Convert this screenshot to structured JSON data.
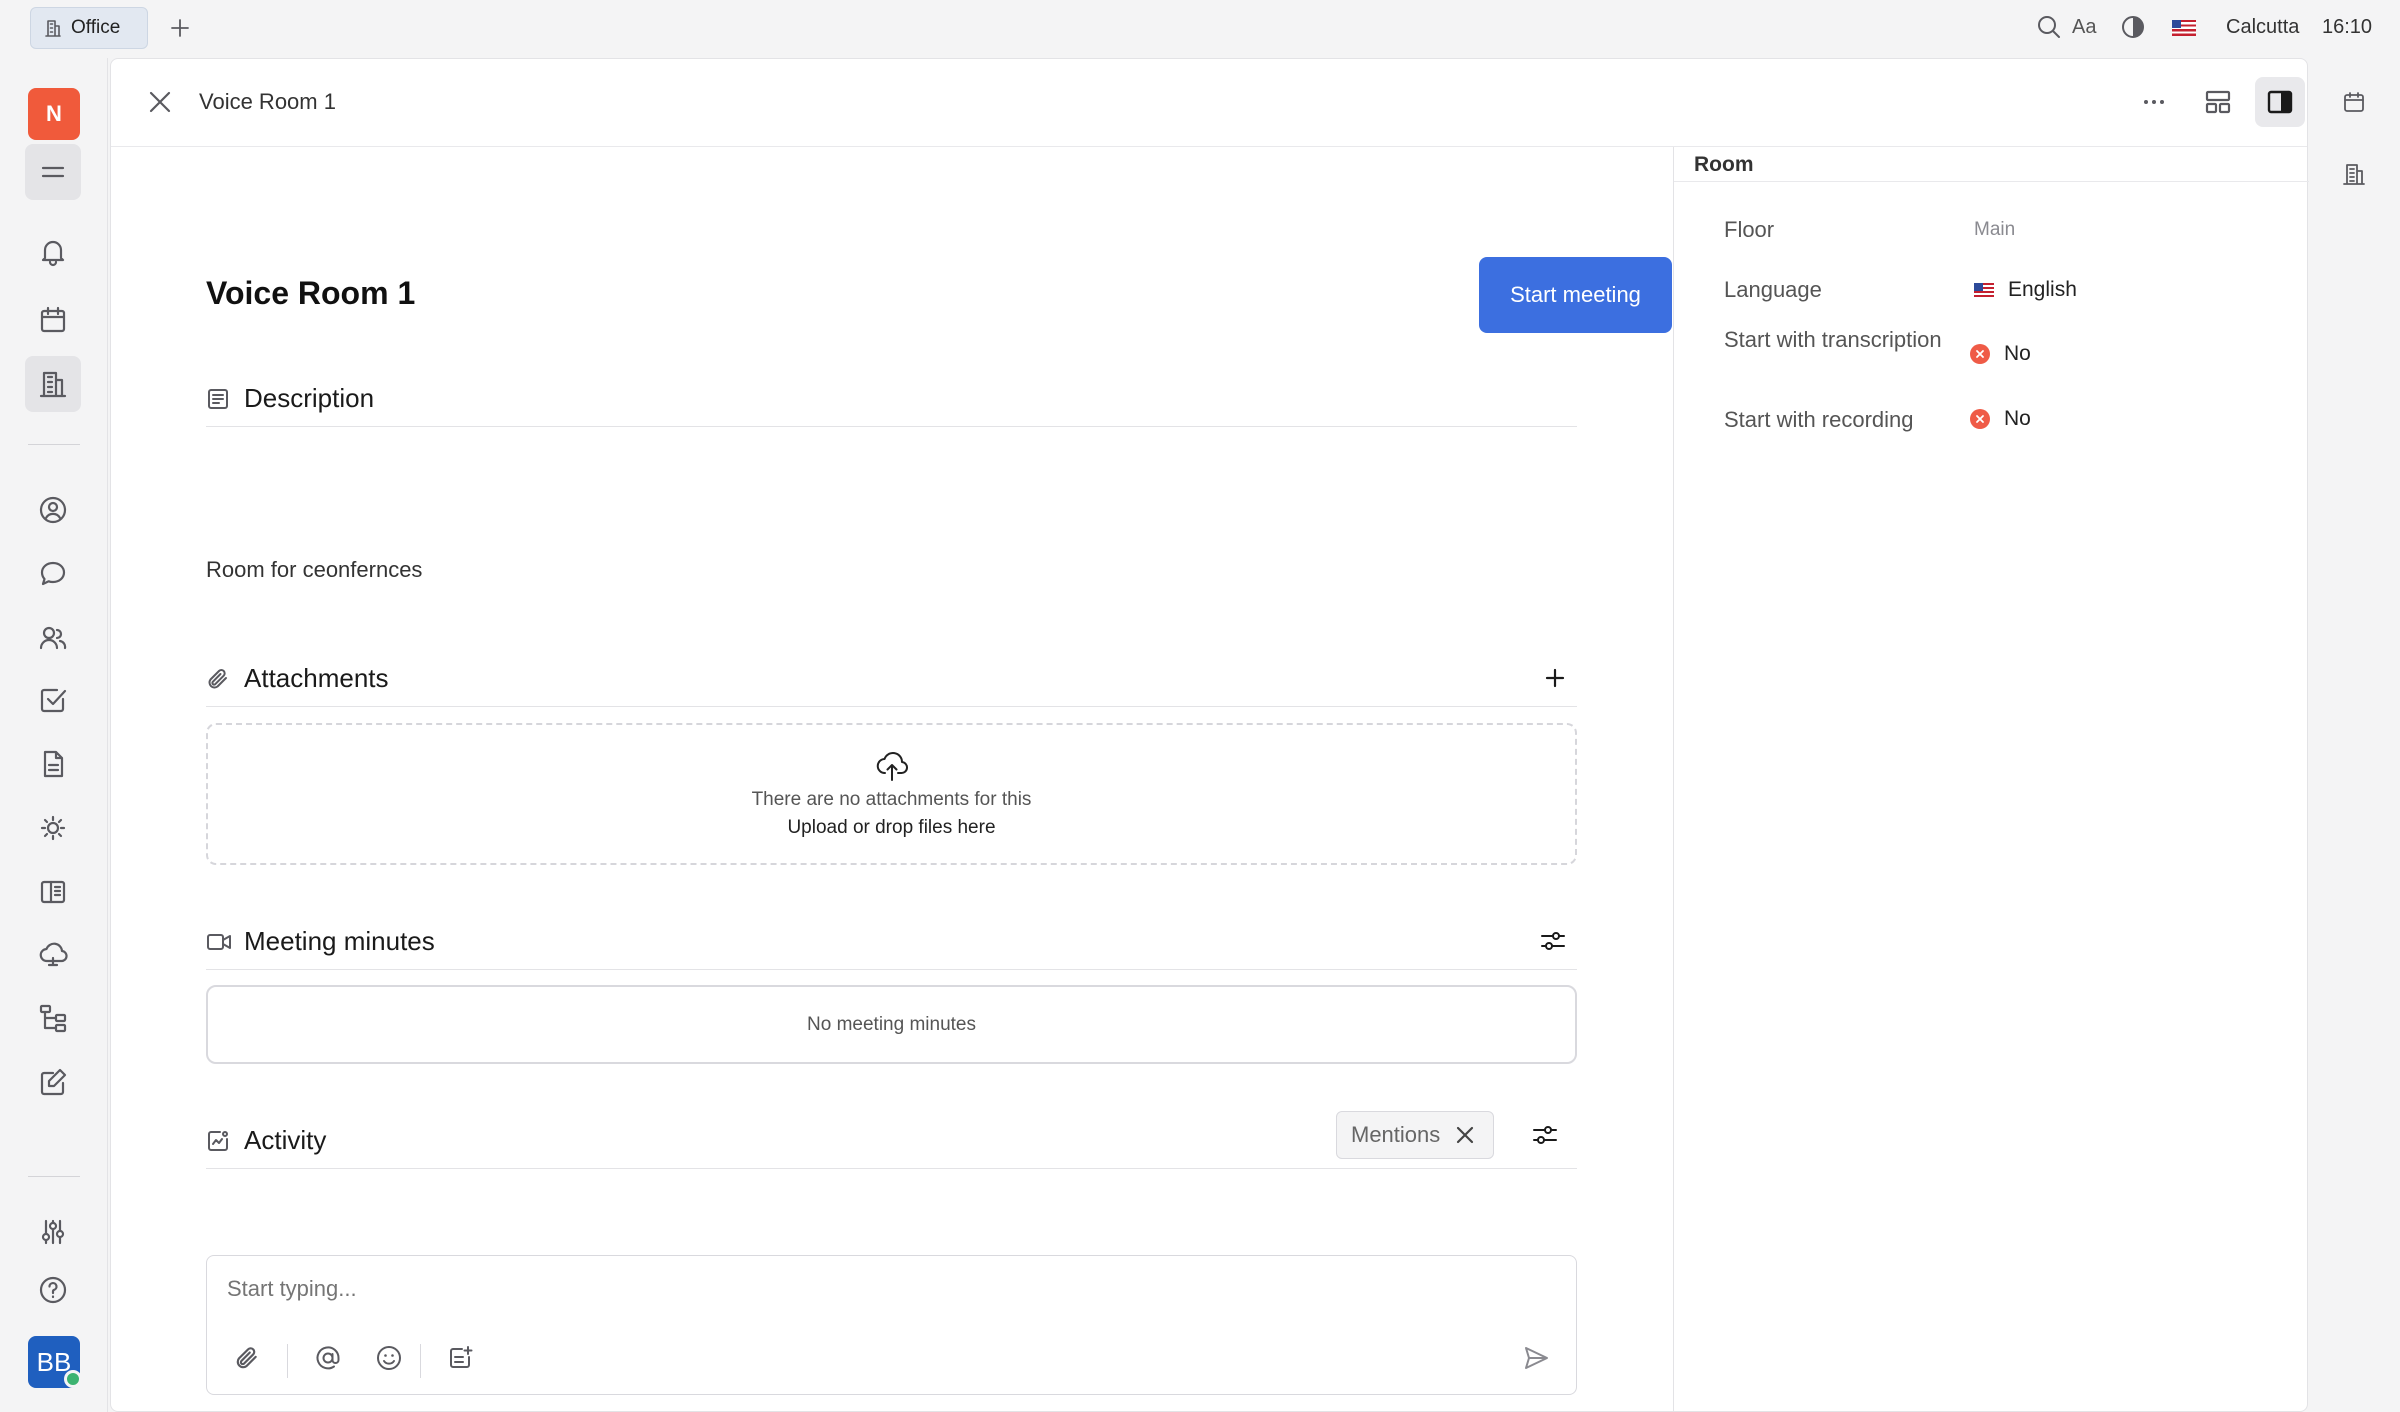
{
  "topbar": {
    "tab_label": "Office",
    "timezone": "Calcutta",
    "time": "16:10",
    "font_toggle_label": "Aa"
  },
  "nav": {
    "workspace_initial": "N",
    "user_initials": "BB",
    "items": [
      "menu",
      "notifications",
      "calendar",
      "office",
      "contacts",
      "chat",
      "team",
      "tasks",
      "documents",
      "planner",
      "drive",
      "cloud",
      "recruiting",
      "edit",
      "settings",
      "help"
    ]
  },
  "header": {
    "title": "Voice Room 1"
  },
  "main": {
    "title": "Voice Room 1",
    "start_meeting_label": "Start meeting",
    "description": {
      "heading": "Description",
      "text": "Room for ceonfernces"
    },
    "attachments": {
      "heading": "Attachments",
      "empty_text": "There are no attachments for this",
      "upload_text": "Upload or drop files here"
    },
    "meeting_minutes": {
      "heading": "Meeting minutes",
      "empty_text": "No meeting minutes"
    },
    "activity": {
      "heading": "Activity",
      "filter_chip": "Mentions"
    },
    "composer": {
      "placeholder": "Start typing..."
    }
  },
  "aside": {
    "title": "Room",
    "props": [
      {
        "label": "Floor",
        "value": "Main"
      },
      {
        "label": "Language",
        "value": "English"
      },
      {
        "label": "Start with transcription",
        "value": "No"
      },
      {
        "label": "Start with recording",
        "value": "No"
      }
    ]
  },
  "colors": {
    "accent": "#3c6fe0",
    "workspace_badge": "#f05a3b",
    "avatar": "#1f5fbf",
    "negative": "#ef5b47"
  }
}
